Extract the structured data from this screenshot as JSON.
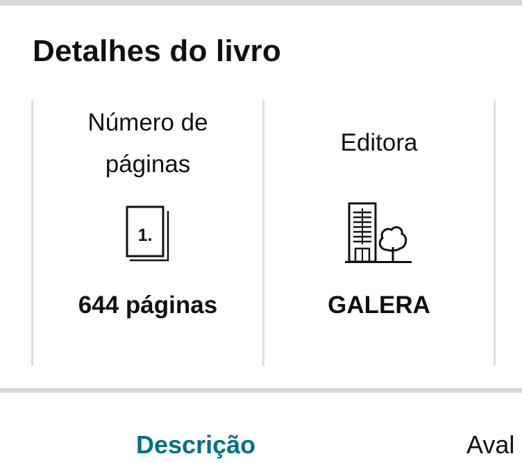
{
  "section": {
    "title": "Detalhes do livro"
  },
  "cards": [
    {
      "label_line1": "Número de",
      "label_line2": "páginas",
      "icon": "page-number-icon",
      "icon_text": "1.",
      "value": "644 páginas"
    },
    {
      "label": "Editora",
      "icon": "building-tree-icon",
      "value": "GALERA"
    }
  ],
  "tabs": [
    {
      "label": "Descrição",
      "active": true
    },
    {
      "label": "Aval",
      "active": false
    }
  ],
  "colors": {
    "tab_active": "#007185",
    "divider": "#dddddd",
    "separator_bar": "#d5d9d9",
    "text": "#0f1111"
  }
}
